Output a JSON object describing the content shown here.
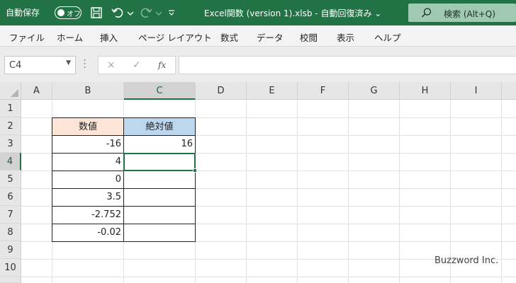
{
  "titlebar": {
    "autosave_label": "自動保存",
    "autosave_state": "オフ",
    "document_title": "Excel関数 (version 1).xlsb  -  自動回復済み  ⌄",
    "search_placeholder": "検索 (Alt+Q)",
    "colors": {
      "bar": "#217346",
      "search_bg": "#9fc9b0"
    }
  },
  "menu": {
    "items": [
      "ファイル",
      "ホーム",
      "挿入",
      "ページ レイアウト",
      "数式",
      "データ",
      "校閲",
      "表示",
      "ヘルプ"
    ]
  },
  "formula_bar": {
    "name_box": "C4",
    "cancel_icon": "×",
    "enter_icon": "✓",
    "fx_label": "fx",
    "formula_value": ""
  },
  "sheet": {
    "columns": [
      "A",
      "B",
      "C",
      "D",
      "E",
      "F",
      "G",
      "H",
      "I"
    ],
    "rows": [
      "1",
      "2",
      "3",
      "4",
      "5",
      "6",
      "7",
      "8",
      "9",
      "10"
    ],
    "active_cell": "C4",
    "table": {
      "header_b": "数値",
      "header_c": "絶対値",
      "header_b_color": "#fce4d6",
      "header_c_color": "#bdd7ee",
      "b_values": [
        "-16",
        "4",
        "0",
        "3.5",
        "-2.752",
        "-0.02"
      ],
      "c_values": [
        "16",
        "",
        "",
        "",
        "",
        ""
      ]
    }
  },
  "watermark": "Buzzword Inc."
}
